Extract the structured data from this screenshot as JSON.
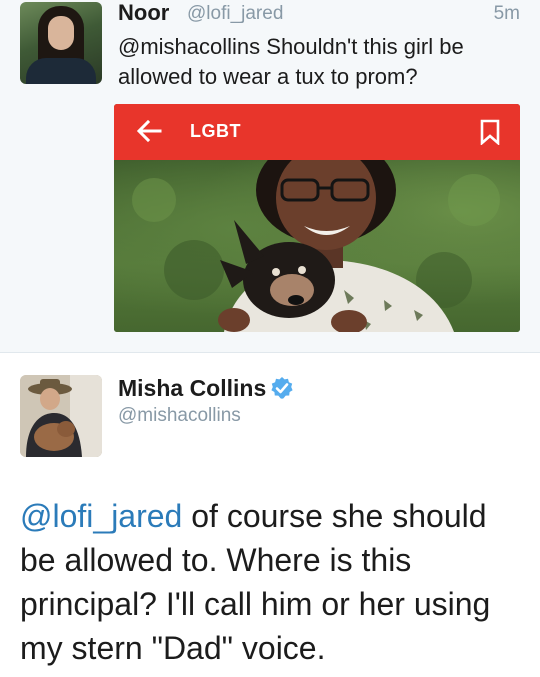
{
  "reply_tweet": {
    "author_name": "Noor",
    "author_handle": "@lofi_jared",
    "timestamp": "5m",
    "text": "@mishacollins Shouldn't this girl be allowed to wear a tux to prom?",
    "card": {
      "label": "LGBT",
      "back_icon": "arrow-left-icon",
      "bookmark_icon": "bookmark-icon",
      "bar_color": "#e8352b"
    }
  },
  "main_tweet": {
    "author_name": "Misha Collins",
    "author_handle": "@mishacollins",
    "verified": true,
    "verified_color": "#55acee",
    "mention": "@lofi_jared",
    "body": " of course she should be allowed to. Where is this principal? I'll call him or her using my stern \"Dad\" voice."
  },
  "colors": {
    "mention_blue": "#2b7bb9",
    "meta_gray": "#8899a6"
  }
}
